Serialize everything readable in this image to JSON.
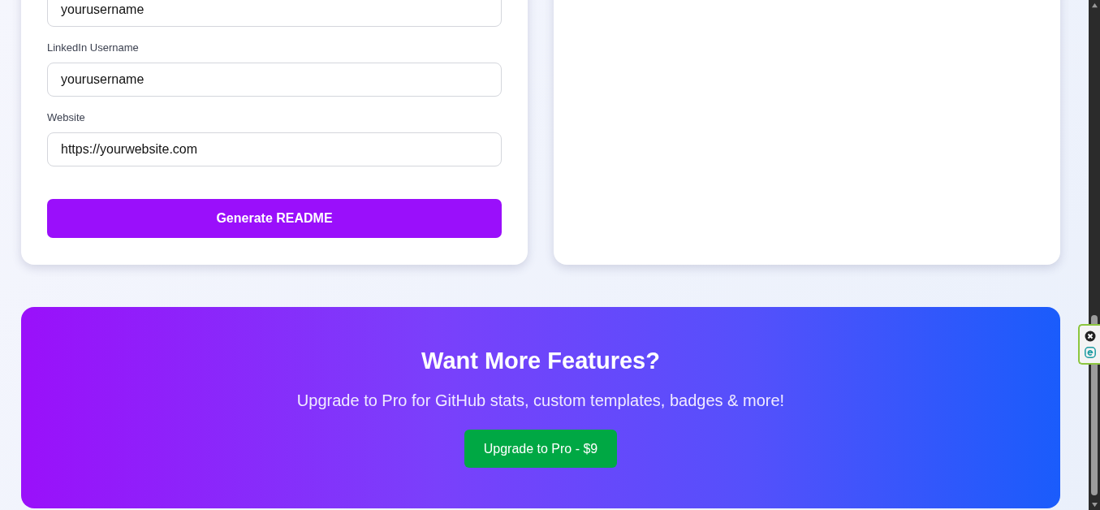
{
  "form": {
    "fields": [
      {
        "value": "yourusername"
      },
      {
        "label": "LinkedIn Username",
        "value": "yourusername"
      },
      {
        "label": "Website",
        "value": "https://yourwebsite.com"
      }
    ],
    "submit_button": "Generate README"
  },
  "promo": {
    "title": "Want More Features?",
    "subtitle": "Upgrade to Pro for GitHub stats, custom templates, badges & more!",
    "button": "Upgrade to Pro - $9"
  }
}
